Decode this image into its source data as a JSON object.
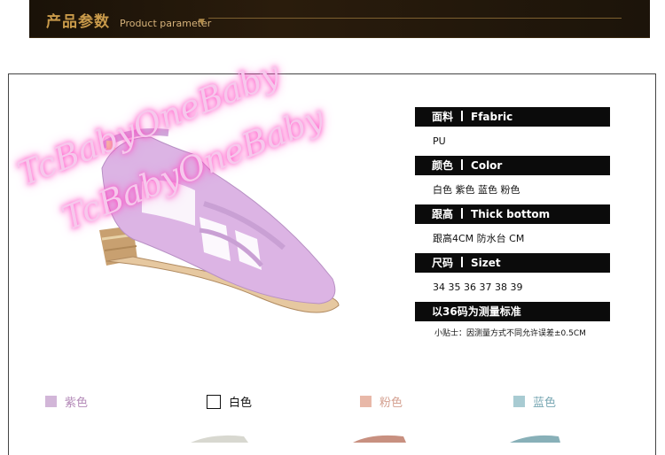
{
  "header": {
    "title": "产品参数",
    "subtitle": "Product parameter",
    "arrow": "▼"
  },
  "watermark": {
    "line1": "TcBabyOneBaby",
    "line2": "TcBabyOneBaby"
  },
  "params": [
    {
      "head_cn": "面料",
      "head_en": "Ffabric",
      "value": "PU"
    },
    {
      "head_cn": "颜色",
      "head_en": "Color",
      "value": "白色  紫色  蓝色  粉色"
    },
    {
      "head_cn": "跟高",
      "head_en": "Thick bottom",
      "value": "跟高4CM    防水台   CM"
    },
    {
      "head_cn": "尺码",
      "head_en": "Sizet",
      "value": "34  35  36  37  38  39"
    }
  ],
  "measure_head": "以36码为测量标准",
  "note": "小贴士：因测量方式不同允许误差±0.5CM",
  "swatches": [
    {
      "label": "紫色",
      "color": "#d2b6d8"
    },
    {
      "label": "白色",
      "color": "#ffffff"
    },
    {
      "label": "粉色",
      "color": "#e8b8a8"
    },
    {
      "label": "蓝色",
      "color": "#a8cbd2"
    }
  ]
}
